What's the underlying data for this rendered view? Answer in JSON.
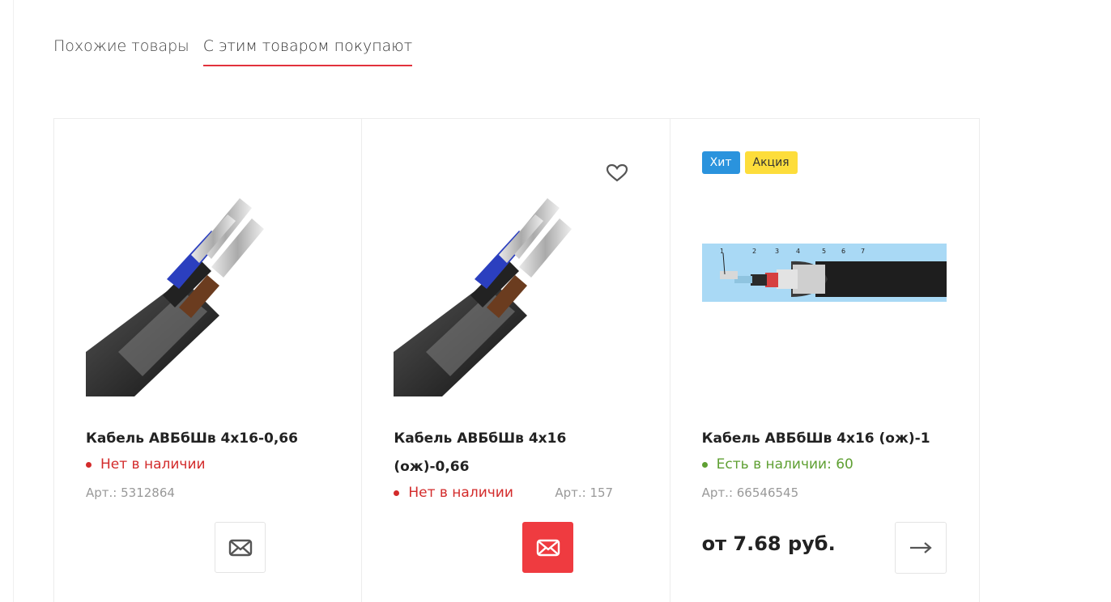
{
  "tabs": [
    {
      "label": "Похожие товары",
      "active": false
    },
    {
      "label": "С этим товаром покупают",
      "active": true
    }
  ],
  "products": [
    {
      "title": "Кабель АВБбШв 4x16-0,66",
      "stock": "Нет в наличии",
      "article": "Арт.: 5312864",
      "image_icon": "cable-photo"
    },
    {
      "title": "Кабель АВБбШв 4x16 (ож)-0,66",
      "stock": "Нет в наличии",
      "article": "Арт.: 157",
      "image_icon": "cable-photo"
    },
    {
      "badges": [
        "Хит",
        "Акция"
      ],
      "title": "Кабель АВБбШв 4x16 (ож)-1",
      "stock": "Есть в наличии: 60",
      "article": "Арт.: 66546545",
      "price": "от 7.68 руб.",
      "image_icon": "cable-structure-diagram",
      "diagram_labels": [
        "1",
        "2",
        "3",
        "4",
        "5",
        "6",
        "7"
      ]
    }
  ],
  "colors": {
    "accent": "#e2313c",
    "out_of_stock": "#d32b2b",
    "in_stock": "#5fa033",
    "badge_hit": "#2a93dd",
    "badge_sale": "#fddd3b",
    "mail_button_active": "#ef3b40"
  }
}
